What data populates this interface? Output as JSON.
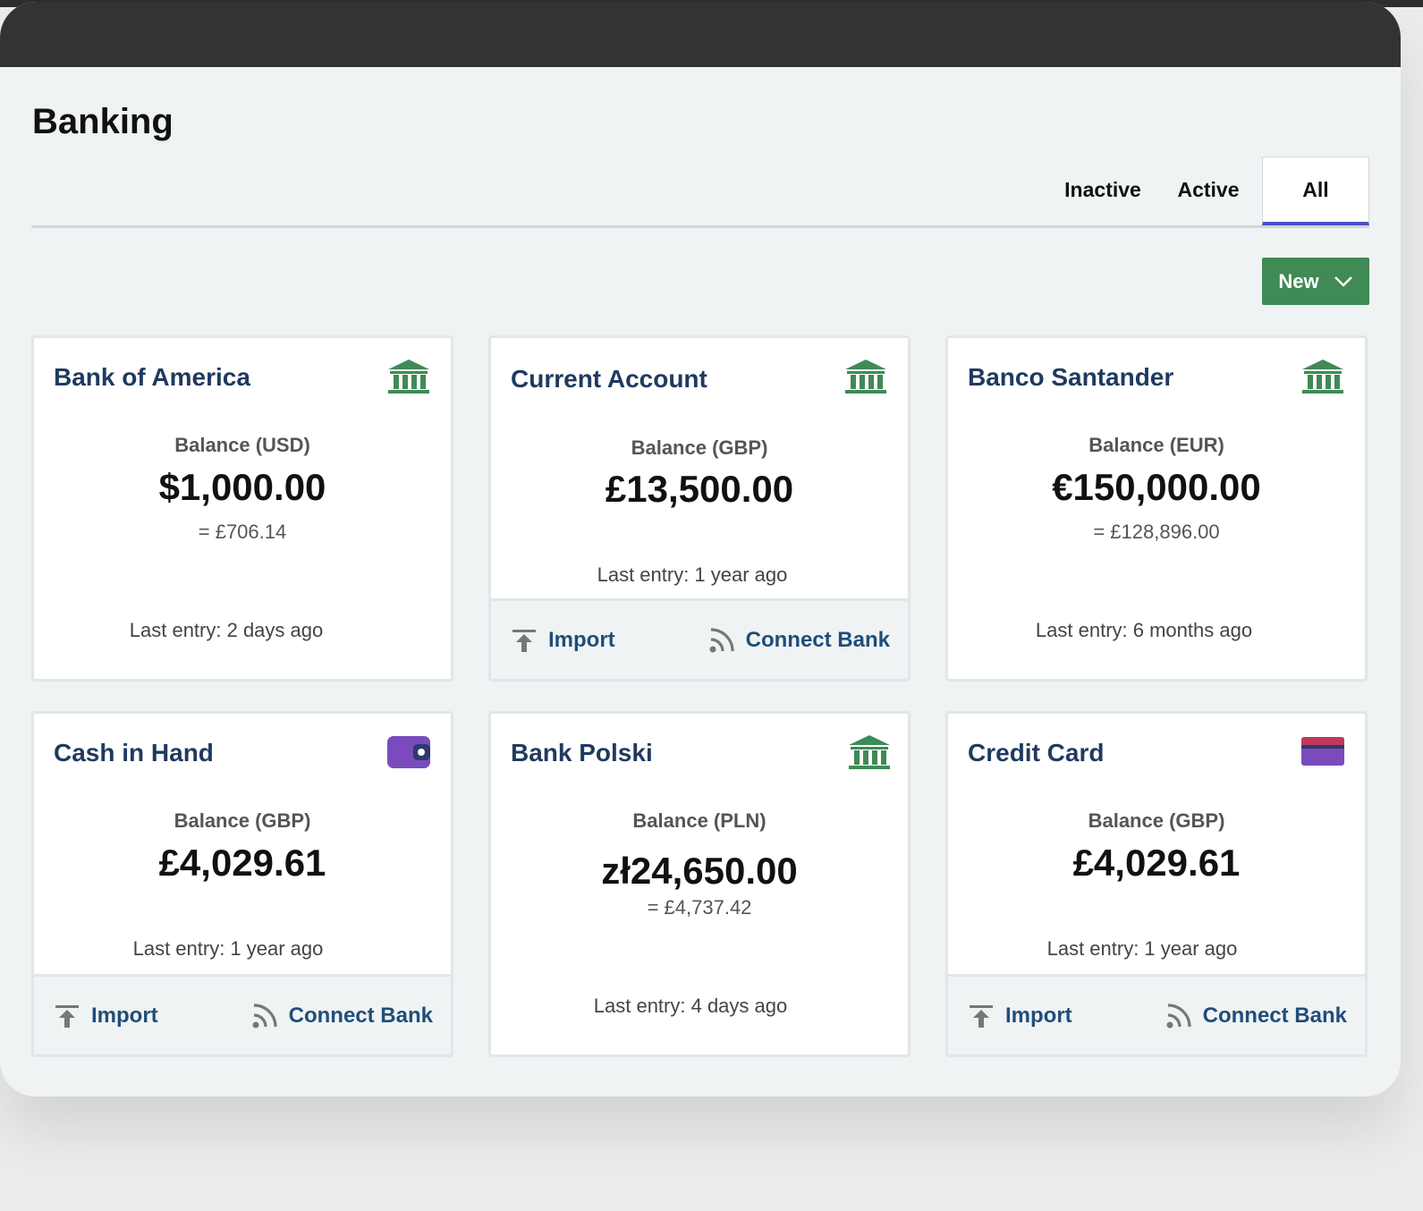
{
  "page": {
    "title": "Banking",
    "tabs": [
      {
        "label": "Inactive"
      },
      {
        "label": "Active"
      },
      {
        "label": "All"
      }
    ],
    "selected_tab": "All",
    "new_button_label": "New"
  },
  "colors": {
    "titlebar": "#333333",
    "accent_tab": "#4a51c6",
    "new_button": "#3f8a55",
    "account_name": "#1f3a5f",
    "bank_icon": "#3f8a55",
    "wallet_icon": "#7a4bbd",
    "card_icon": "#c0395a"
  },
  "accounts": [
    {
      "name": "Bank of America",
      "icon": "bank-icon",
      "balance_label": "Balance (USD)",
      "balance": "$1,000.00",
      "converted": "= £706.14",
      "last_entry": "Last entry: 2 days ago"
    },
    {
      "name": "Current Account",
      "icon": "bank-icon",
      "balance_label": "Balance (GBP)",
      "balance": "£13,500.00",
      "last_entry": "Last entry: 1 year ago",
      "import_label": "Import",
      "connect_label": "Connect Bank"
    },
    {
      "name": "Banco Santander",
      "icon": "bank-icon",
      "balance_label": "Balance (EUR)",
      "balance": "€150,000.00",
      "converted": "= £128,896.00",
      "last_entry": "Last entry: 6 months ago"
    },
    {
      "name": "Cash in Hand",
      "icon": "wallet-icon",
      "balance_label": "Balance (GBP)",
      "balance": "£4,029.61",
      "last_entry": "Last entry: 1 year ago",
      "import_label": "Import",
      "connect_label": "Connect Bank"
    },
    {
      "name": "Bank Polski",
      "icon": "bank-icon",
      "balance_label": "Balance (PLN)",
      "balance": "zł24,650.00",
      "converted": "= £4,737.42",
      "last_entry": "Last entry: 4 days ago"
    },
    {
      "name": "Credit Card",
      "icon": "credit-card-icon",
      "balance_label": "Balance (GBP)",
      "balance": "£4,029.61",
      "last_entry": "Last entry: 1 year ago",
      "import_label": "Import",
      "connect_label": "Connect Bank"
    }
  ]
}
